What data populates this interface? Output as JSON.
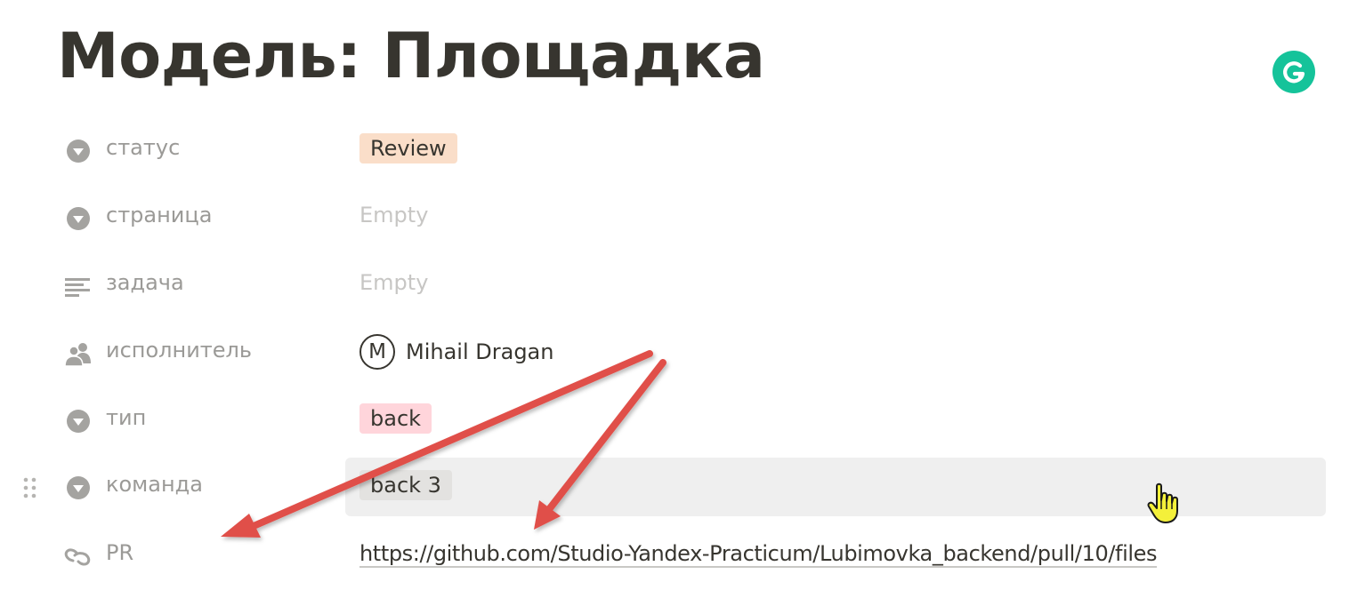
{
  "page": {
    "title": "Модель: Площадка"
  },
  "grammarly": {
    "icon": "grammarly-icon",
    "color": "#15c39a"
  },
  "properties": [
    {
      "icon": "select-icon",
      "label": "статус",
      "type": "select",
      "value": "Review",
      "tag_color": "#fadec9"
    },
    {
      "icon": "select-icon",
      "label": "страница",
      "type": "empty",
      "value": "Empty"
    },
    {
      "icon": "text-icon",
      "label": "задача",
      "type": "empty",
      "value": "Empty"
    },
    {
      "icon": "person-icon",
      "label": "исполнитель",
      "type": "person",
      "avatar_initial": "M",
      "value": "Mihail Dragan"
    },
    {
      "icon": "select-icon",
      "label": "тип",
      "type": "select",
      "value": "back",
      "tag_color": "#ffd5db"
    },
    {
      "icon": "select-icon",
      "label": "команда",
      "type": "select",
      "value": "back 3",
      "tag_color": "#e3e2e0"
    },
    {
      "icon": "url-icon",
      "label": "PR",
      "type": "url",
      "value": "https://github.com/Studio-Yandex-Practicum/Lubimovka_backend/pull/10/files"
    }
  ],
  "annotations": {
    "arrow_color": "#e0504a"
  }
}
